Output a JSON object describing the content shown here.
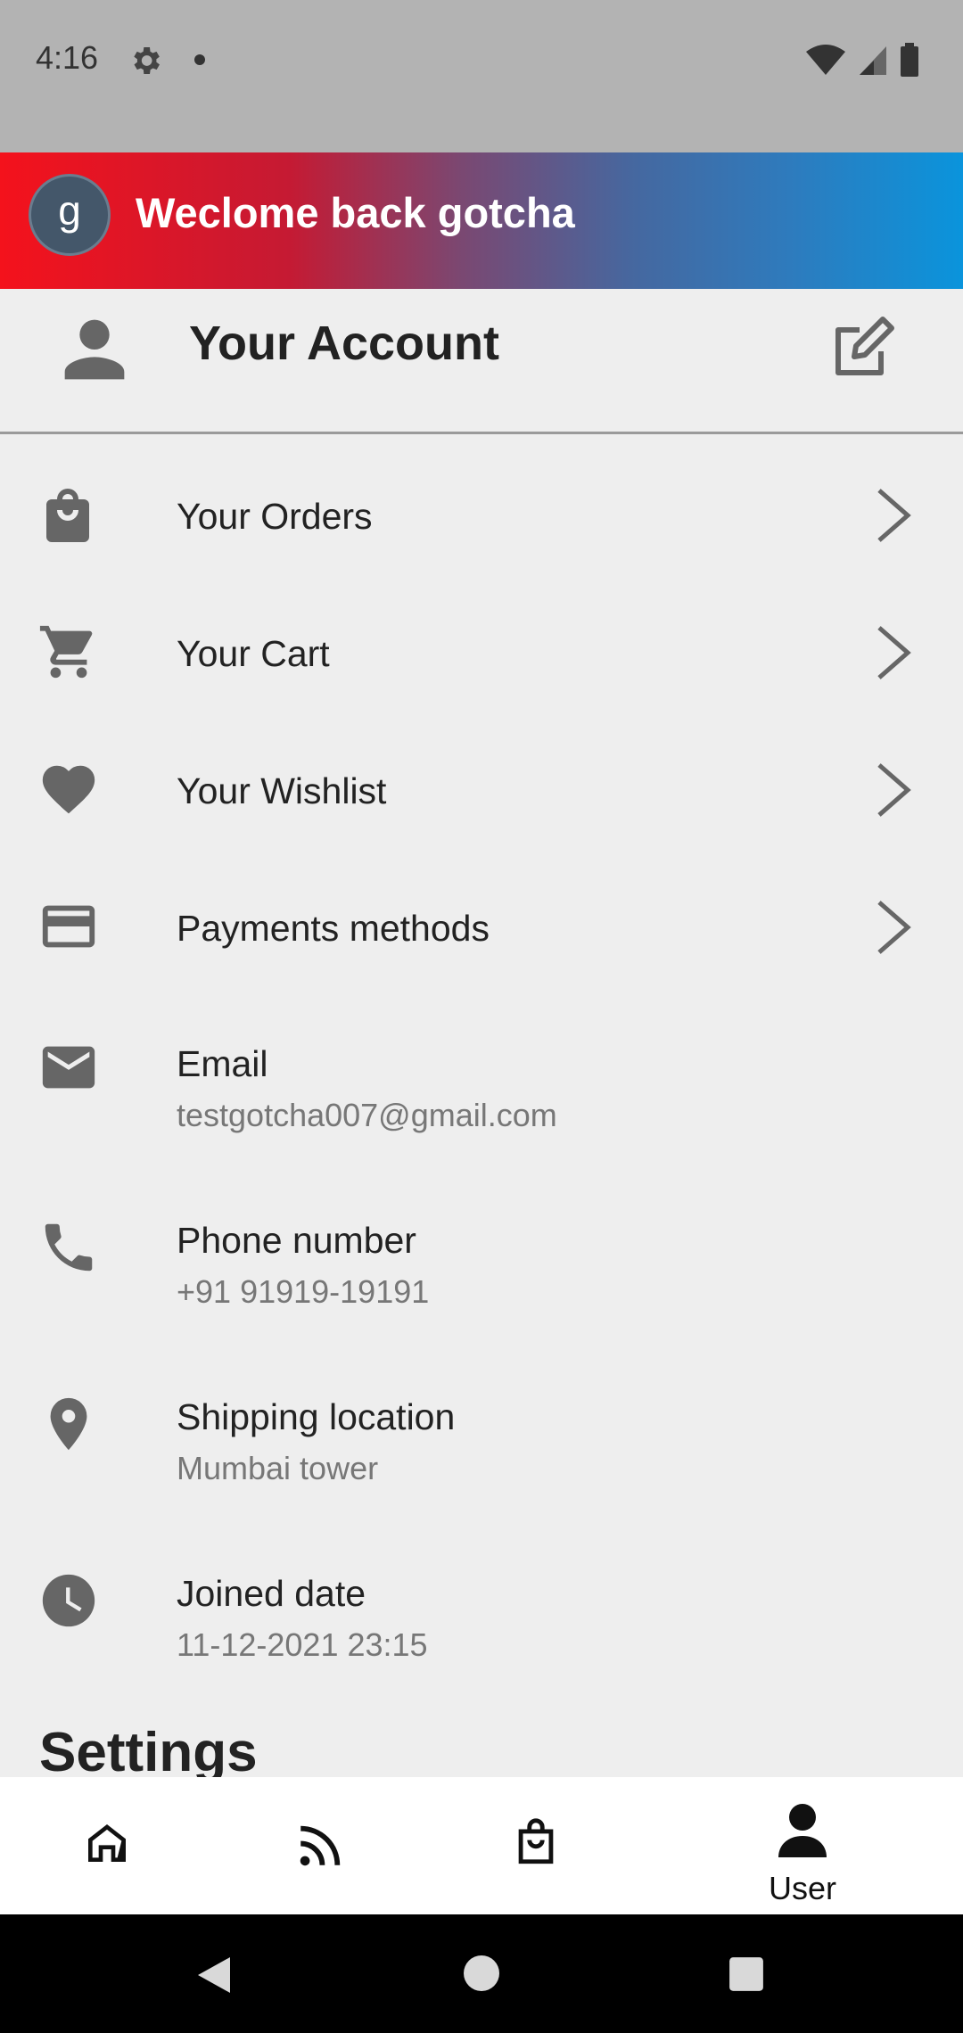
{
  "status_bar": {
    "time": "4:16"
  },
  "banner": {
    "avatar_letter": "g",
    "text": "Weclome back gotcha"
  },
  "header": {
    "title": "Your Account"
  },
  "menu_items": [
    {
      "label": "Your Orders",
      "icon": "shopping-bag-icon"
    },
    {
      "label": "Your Cart",
      "icon": "cart-icon"
    },
    {
      "label": "Your Wishlist",
      "icon": "heart-icon"
    },
    {
      "label": "Payments methods",
      "icon": "credit-card-icon"
    }
  ],
  "info_items": [
    {
      "label": "Email",
      "value": "testgotcha007@gmail.com",
      "icon": "mail-icon"
    },
    {
      "label": "Phone number",
      "value": "+91 91919-19191",
      "icon": "phone-icon"
    },
    {
      "label": "Shipping location",
      "value": "Mumbai tower",
      "icon": "location-pin-icon"
    },
    {
      "label": "Joined date",
      "value": "11-12-2021 23:15",
      "icon": "clock-icon"
    }
  ],
  "settings": {
    "title": "Settings"
  },
  "bottom_nav": {
    "items": [
      {
        "icon": "home-icon"
      },
      {
        "icon": "feed-icon"
      },
      {
        "icon": "shopping-bag-icon"
      },
      {
        "icon": "user-icon",
        "label": "User"
      }
    ]
  },
  "colors": {
    "banner_gradient_start": "#f4121c",
    "banner_gradient_end": "#0a94dc",
    "icon_grey": "#666666"
  }
}
